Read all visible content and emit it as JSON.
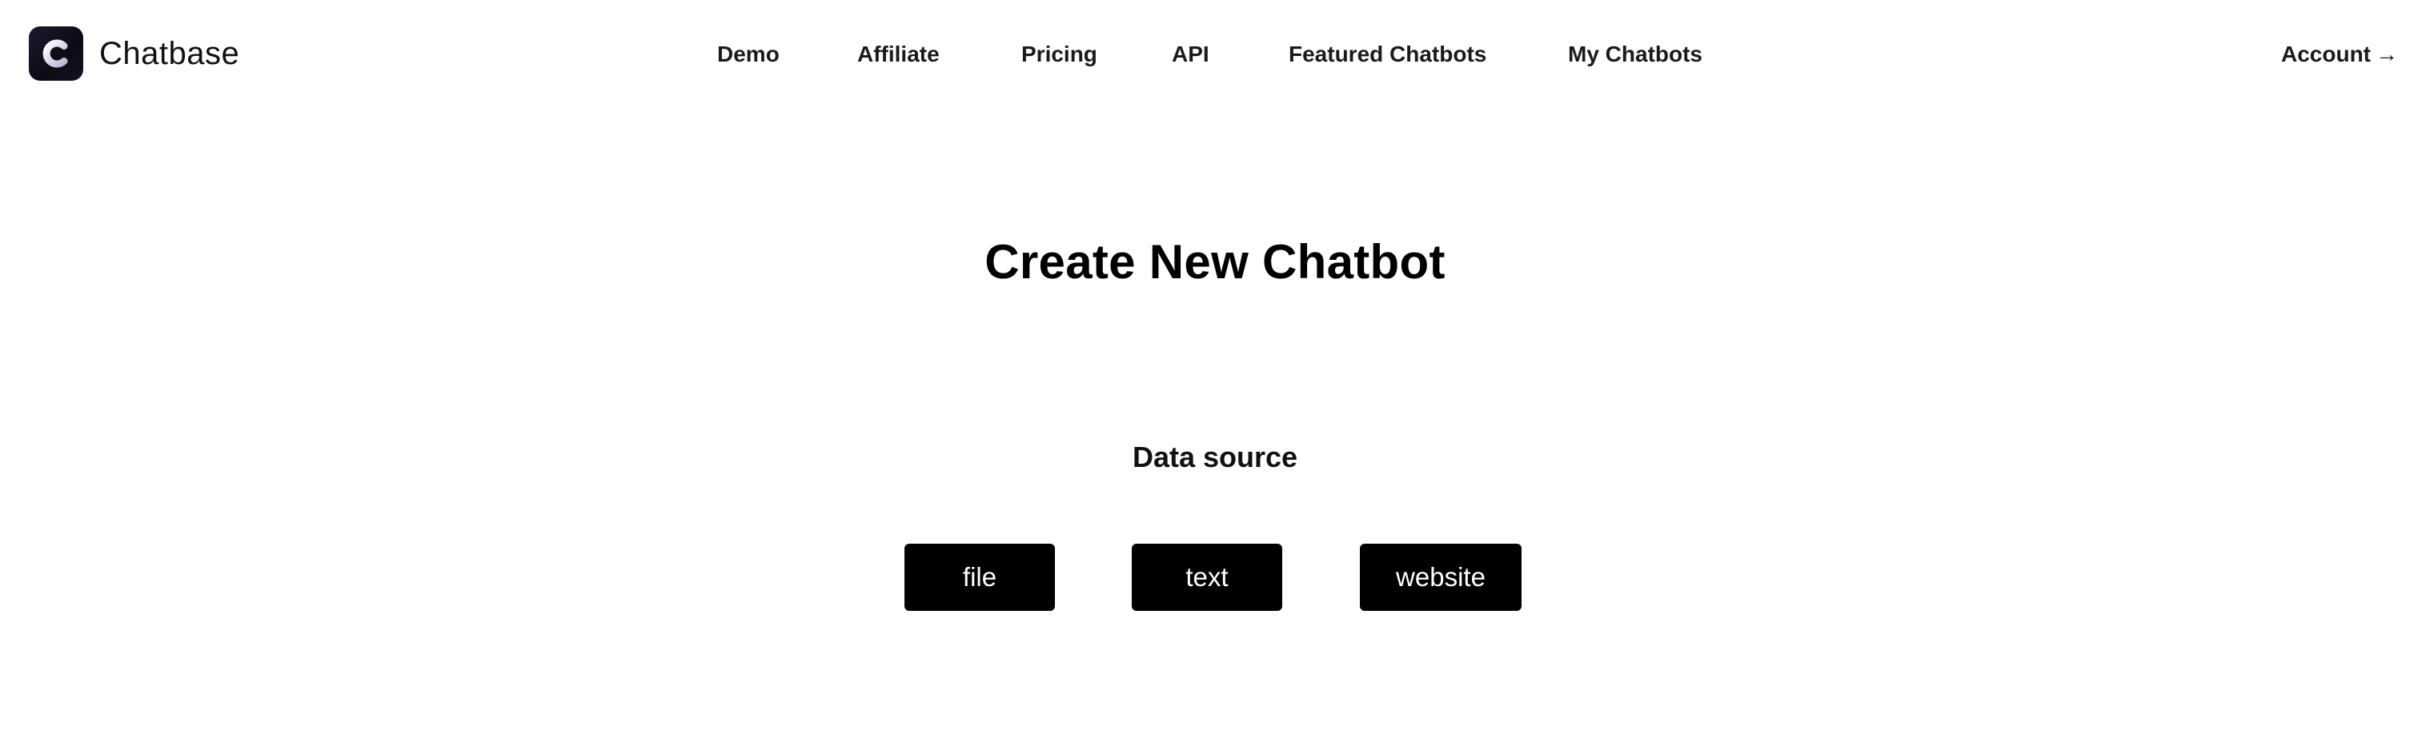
{
  "header": {
    "brand": {
      "logo_letter": "C",
      "name": "Chatbase",
      "logo_icon": "chatbase-c-logo"
    },
    "nav": [
      {
        "label": "Demo"
      },
      {
        "label": "Affiliate"
      },
      {
        "label": "Pricing"
      },
      {
        "label": "API"
      },
      {
        "label": "Featured Chatbots"
      },
      {
        "label": "My Chatbots"
      }
    ],
    "account": {
      "label": "Account",
      "arrow": "→",
      "arrow_icon": "arrow-right-icon"
    }
  },
  "main": {
    "title": "Create New Chatbot",
    "data_source_label": "Data source",
    "source_buttons": [
      {
        "label": "file"
      },
      {
        "label": "text"
      },
      {
        "label": "website"
      }
    ]
  },
  "colors": {
    "background": "#ffffff",
    "text": "#111111",
    "button_bg": "#000000",
    "button_text": "#ffffff",
    "logo_bg": "#14121f"
  }
}
